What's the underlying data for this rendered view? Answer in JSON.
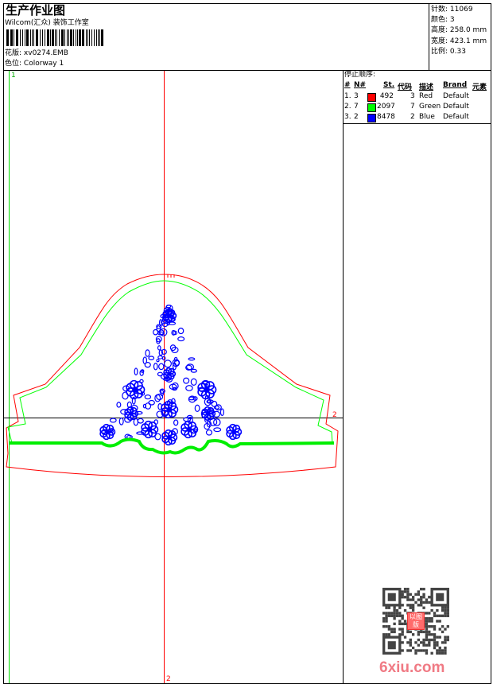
{
  "header": {
    "title": "生产作业图",
    "company": "Wilcom(汇众) 装饰工作室",
    "design_label": "花版:",
    "design_value": "xv0274.EMB",
    "colorway_label": "色位:",
    "colorway_value": "Colorway 1"
  },
  "stats": {
    "stitches_label": "针数:",
    "stitches": "11069",
    "colors_label": "颜色:",
    "colors": "3",
    "height_label": "高度:",
    "height": "258.0 mm",
    "width_label": "宽度:",
    "width": "423.1 mm",
    "scale_label": "比例:",
    "scale": "0.33"
  },
  "stop_sequence": {
    "title": "停止顺序:",
    "columns": [
      "#",
      "N#",
      "St.",
      "代码",
      "描述",
      "Brand",
      "元素"
    ],
    "rows": [
      {
        "idx": "1.",
        "n": "3",
        "color": "#ff0000",
        "st": "492",
        "code": "3",
        "desc": "Red",
        "brand": "Default"
      },
      {
        "idx": "2.",
        "n": "7",
        "color": "#00ff00",
        "st": "2097",
        "code": "7",
        "desc": "Green",
        "brand": "Default"
      },
      {
        "idx": "3.",
        "n": "2",
        "color": "#0000ff",
        "st": "8478",
        "code": "2",
        "desc": "Blue",
        "brand": "Default"
      }
    ]
  },
  "canvas": {
    "marker_1": "1",
    "marker_2_right": "2",
    "marker_2_bottom": "2"
  },
  "watermark": {
    "site": "6xiu.com",
    "stamp": "以图版"
  }
}
